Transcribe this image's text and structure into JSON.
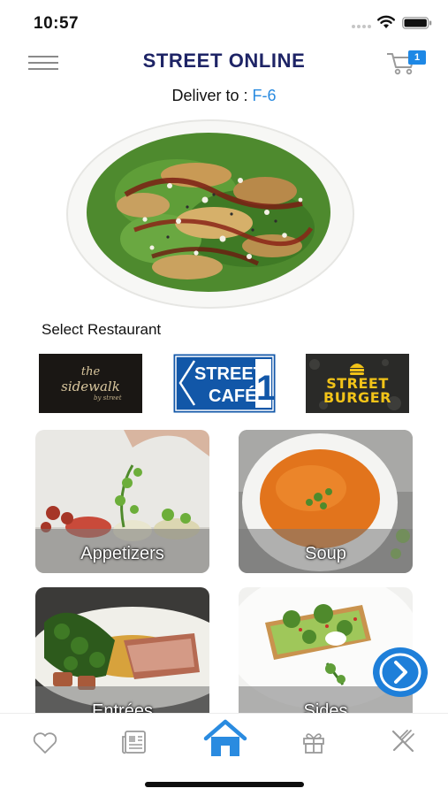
{
  "status_bar": {
    "time": "10:57"
  },
  "header": {
    "title": "STREET ONLINE",
    "cart_count": "1"
  },
  "delivery": {
    "label": "Deliver to : ",
    "value": "F-6"
  },
  "restaurants": {
    "section_label": "Select Restaurant",
    "items": [
      {
        "name": "the sidewalk",
        "line1": "the",
        "line2": "sidewalk",
        "line3": "by street"
      },
      {
        "name": "STREET CAFÉ 1",
        "line1": "STREET",
        "line2": "CAFÉ",
        "number": "1"
      },
      {
        "name": "STREET BURGER",
        "line1": "STREET",
        "line2": "BURGER"
      }
    ]
  },
  "categories": [
    {
      "label": "Appetizers"
    },
    {
      "label": "Soup"
    },
    {
      "label": "Entrées"
    },
    {
      "label": "Sides"
    }
  ],
  "tabbar": {
    "items": [
      {
        "name": "Favorites",
        "icon": "heart-icon",
        "active": false
      },
      {
        "name": "News",
        "icon": "newspaper-icon",
        "active": false
      },
      {
        "name": "Home",
        "icon": "home-icon",
        "active": true
      },
      {
        "name": "Rewards",
        "icon": "gift-icon",
        "active": false
      },
      {
        "name": "Menu",
        "icon": "fork-knife-icon",
        "active": false
      }
    ]
  },
  "colors": {
    "title": "#1e2466",
    "accent": "#2a8be0",
    "cafe_blue": "#1257a8",
    "burger_yellow": "#f2c318"
  }
}
